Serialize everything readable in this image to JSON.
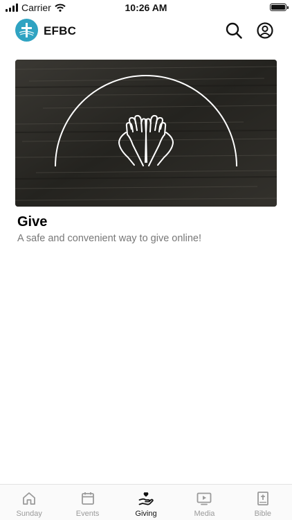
{
  "status_bar": {
    "carrier": "Carrier",
    "time": "10:26 AM"
  },
  "header": {
    "title": "EFBC",
    "search_icon": "search-icon",
    "profile_icon": "profile-icon"
  },
  "card": {
    "title": "Give",
    "subtitle": "A safe and convenient way to give online!",
    "image_icon": "praying-hands-icon"
  },
  "tabs": [
    {
      "label": "Sunday",
      "icon": "home-icon",
      "active": false
    },
    {
      "label": "Events",
      "icon": "calendar-icon",
      "active": false
    },
    {
      "label": "Giving",
      "icon": "giving-hand-heart-icon",
      "active": true
    },
    {
      "label": "Media",
      "icon": "play-icon",
      "active": false
    },
    {
      "label": "Bible",
      "icon": "bible-icon",
      "active": false
    }
  ],
  "colors": {
    "brand": "#2fa3c2",
    "active_tab": "#111111",
    "inactive_tab": "#9a9a9a"
  }
}
